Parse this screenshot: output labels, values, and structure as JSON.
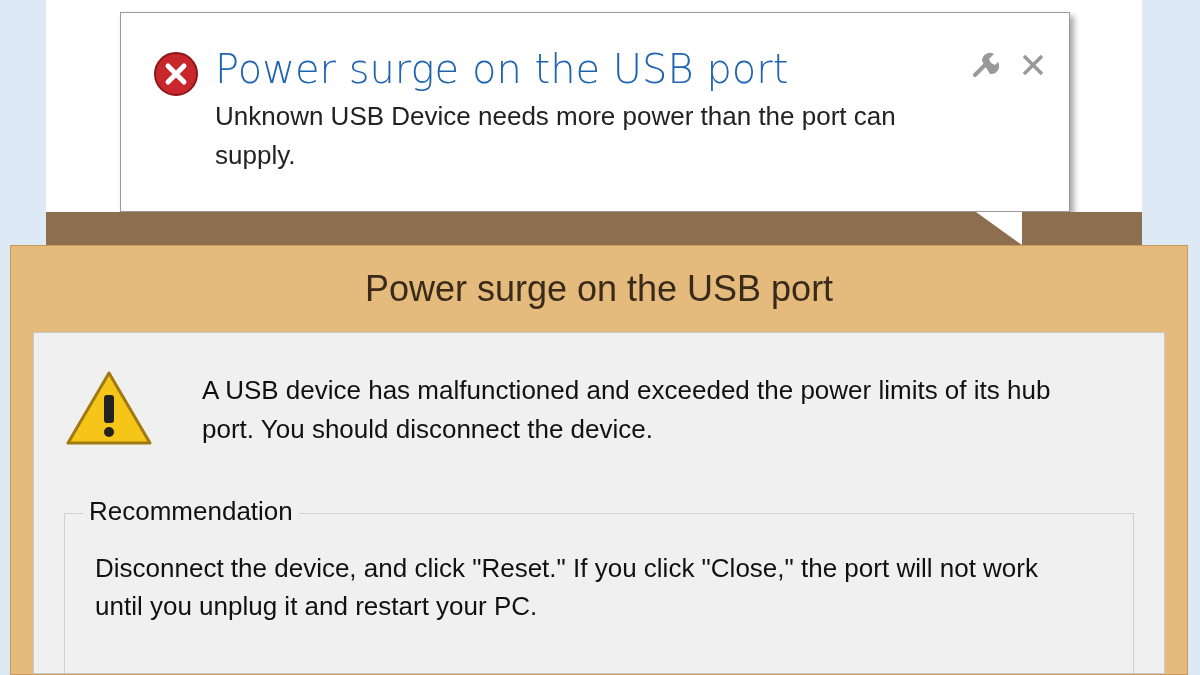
{
  "notification": {
    "title": "Power surge on the USB port",
    "message": "Unknown USB Device needs more power than the port can supply."
  },
  "dialog": {
    "title": "Power surge on the USB port",
    "message": "A USB device has malfunctioned and exceeded the power limits of its hub port. You should disconnect the device.",
    "recommendation": {
      "heading": "Recommendation",
      "text": "Disconnect the device, and click \"Reset.\" If you click \"Close,\" the port will not work until you unplug it and restart your PC."
    }
  }
}
